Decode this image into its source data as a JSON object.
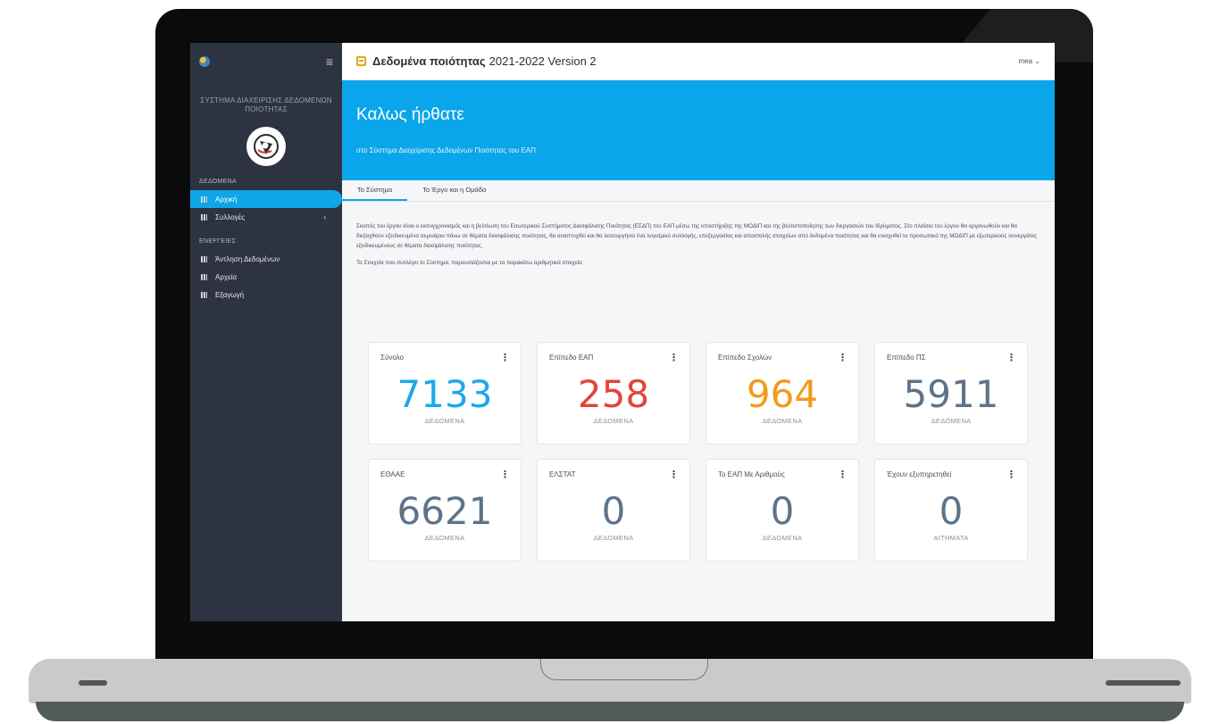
{
  "topbar": {
    "title_bold": "Δεδομένα ποιότητας",
    "title_rest": "2021-2022 Version 2",
    "user": "mea ⌄"
  },
  "sidebar": {
    "system_title": "ΣΥΣΤΗΜΑ ΔΙΑΧΕΙΡΙΣΗΣ ΔΕΔΟΜΕΝΩΝ ΠΟΙΟΤΗΤΑΣ",
    "section_data": "ΔΕΔΟΜΕΝΑ",
    "items_data": [
      {
        "label": "Αρχική",
        "active": true
      },
      {
        "label": "Συλλογές",
        "arrow": "›"
      }
    ],
    "section_actions": "ΕΝΕΡΓΕΙΕΣ",
    "items_actions": [
      {
        "label": "Άντληση Δεδομένων"
      },
      {
        "label": "Αρχεία"
      },
      {
        "label": "Εξαγωγή"
      }
    ]
  },
  "hero": {
    "heading": "Καλως ήρθατε",
    "subtitle": "στο Σύστημα Διαχείρισης Δεδομένων Ποιότητας του ΕΑΠ"
  },
  "tabs": [
    {
      "label": "Το Σύστημα",
      "active": true
    },
    {
      "label": "Το Έργο και η Ομάδα",
      "active": false
    }
  ],
  "content": {
    "paragraph": "Σκοπός του έργου είναι ο εκσυγχρονισμός και η βελτίωση του Εσωτερικού Συστήματος Διασφάλισης Ποιότητας (ΕΣΔΠ) του ΕΑΠ μέσω της υποστήριξης της ΜΟΔΙΠ και της βελτιστοποίησης των διεργασιών του Ιδρύματος. Στο πλαίσιο του έργου θα οργανωθούν και θα διεξαχθούν εξειδικευμένα σεμινάρια πάνω σε θέματα διασφάλισης ποιότητας, θα αναπτυχθεί και θα λειτουργήσει ένα λογισμικό συλλογής, επεξεργασίας και αποστολής στοιχείων από δεδομένα ποιότητας και θα ενισχυθεί το προσωπικό της ΜΟΔΙΠ με εξωτερικούς συνεργάτες εξειδικευμένους σε θέματα διασφάλισης ποιότητας.",
    "paragraph2": "Τα Στοιχεία που συλλέγει το Σύστημα, παρουσιάζονται με τα παρακάτω αριθμητικά στοιχεία"
  },
  "cards": [
    {
      "label": "Σύνολο",
      "value": "7133",
      "sub": "ΔΕΔΟΜΕΝΑ",
      "color": "#1ba8ea"
    },
    {
      "label": "Επίπεδο ΕΑΠ",
      "value": "258",
      "sub": "ΔΕΔΟΜΕΝΑ",
      "color": "#e5423b"
    },
    {
      "label": "Επίπεδο Σχολών",
      "value": "964",
      "sub": "ΔΕΔΟΜΕΝΑ",
      "color": "#f39a1a"
    },
    {
      "label": "Επίπεδο ΠΣ",
      "value": "5911",
      "sub": "ΔΕΔΟΜΕΝΑ",
      "color": "#5d7389"
    },
    {
      "label": "ΕΘΑΑΕ",
      "value": "6621",
      "sub": "ΔΕΔΟΜΕΝΑ",
      "color": "#5d7389"
    },
    {
      "label": "ΕΛΣΤΑΤ",
      "value": "0",
      "sub": "ΔΕΔΟΜΕΝΑ",
      "color": "#5d7389"
    },
    {
      "label": "Το ΕΑΠ Με Αριθμούς",
      "value": "0",
      "sub": "ΔΕΔΟΜΕΝΑ",
      "color": "#5d7389"
    },
    {
      "label": "Έχουν εξυπηρετηθεί",
      "value": "0",
      "sub": "ΑΙΤΗΜΑΤΑ",
      "color": "#5d7389"
    }
  ],
  "icons": {
    "menu": "hamburger-icon",
    "card_menu": "kebab-icon",
    "nav": "grid-icon"
  }
}
